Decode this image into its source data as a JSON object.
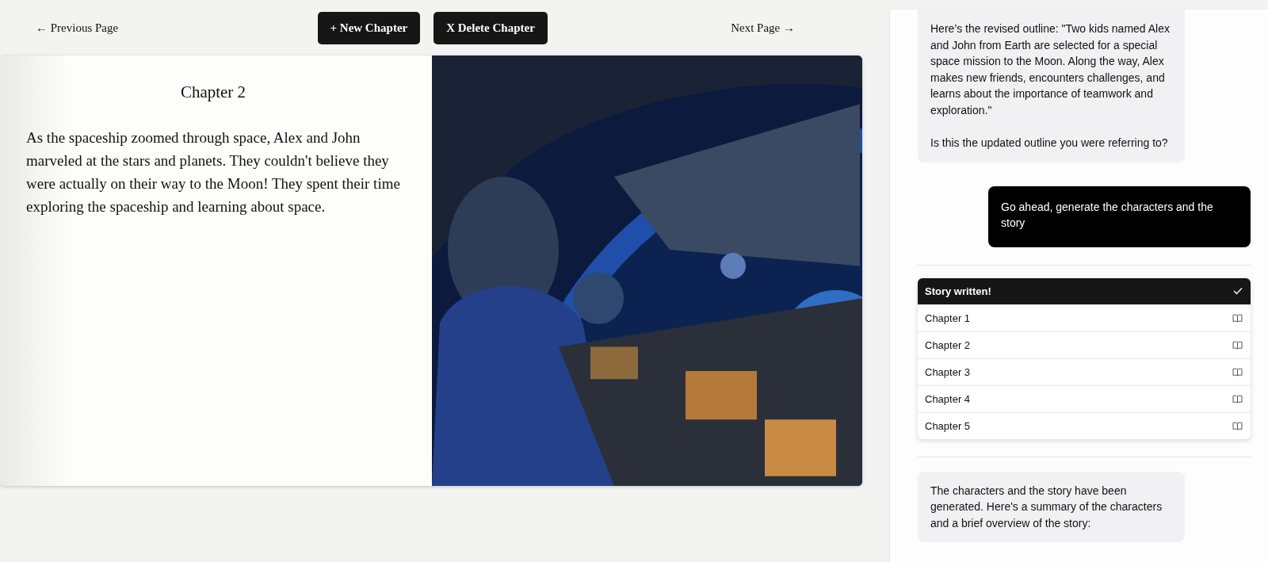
{
  "nav": {
    "previous": "← Previous Page",
    "next": "Next Page →",
    "new_chapter": "+ New Chapter",
    "delete_chapter": "X Delete Chapter"
  },
  "page": {
    "title": "Chapter 2",
    "text": "As the spaceship zoomed through space, Alex and John marveled at the stars and planets. They couldn't believe they were actually on their way to the Moon! They spent their time exploring the spaceship and learning about space."
  },
  "chat": {
    "messages": [
      {
        "kind": "assistant",
        "paragraphs": [
          "Here’s the revised outline: \"Two kids named Alex and John from Earth are selected for a special space mission to the Moon. Along the way, Alex makes new friends, encounters challenges, and learns about the importance of teamwork and exploration.\"",
          "Is this the updated outline you were referring to?"
        ]
      },
      {
        "kind": "user",
        "paragraphs": [
          "Go ahead, generate the characters and the story"
        ]
      },
      {
        "kind": "story",
        "status": "Story written!",
        "done": true,
        "chapters": [
          "Chapter 1",
          "Chapter 2",
          "Chapter 3",
          "Chapter 4",
          "Chapter 5"
        ]
      },
      {
        "kind": "assistant",
        "paragraphs": [
          "The characters and the story have been generated. Here's a summary of the characters and a brief overview of the story:"
        ]
      }
    ]
  }
}
